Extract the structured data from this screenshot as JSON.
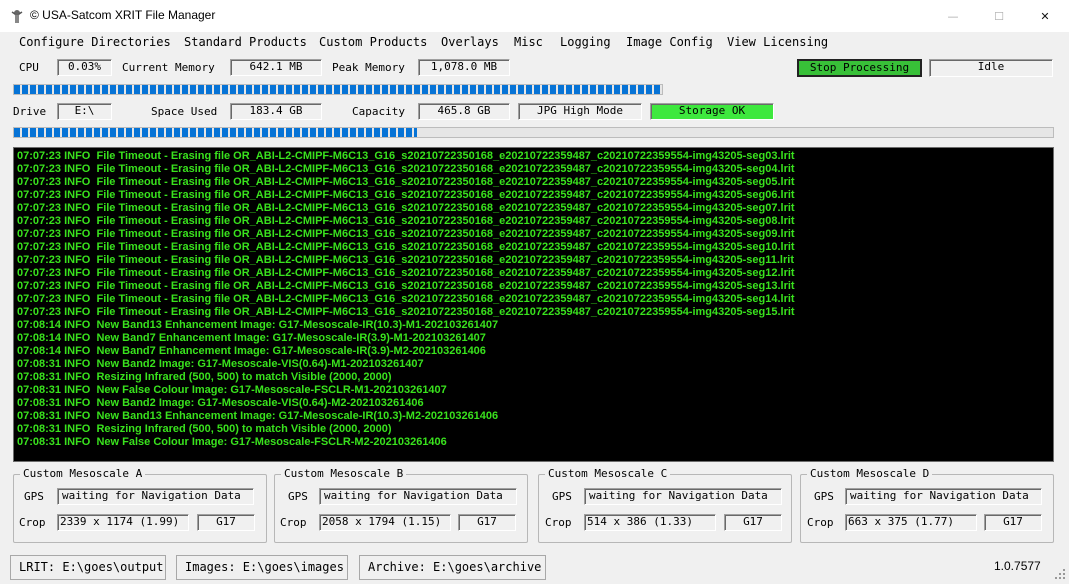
{
  "window": {
    "title": "© USA-Satcom XRIT File Manager",
    "minimize": "—",
    "maximize": "☐",
    "close": "✕"
  },
  "menu": [
    "Configure Directories",
    "Standard Products",
    "Custom Products",
    "Overlays",
    "Misc",
    "Logging",
    "Image Config",
    "View Licensing"
  ],
  "stats": {
    "cpu_label": "CPU",
    "cpu_value": "0.03%",
    "current_memory_label": "Current Memory",
    "current_memory_value": "642.1 MB",
    "peak_memory_label": "Peak Memory",
    "peak_memory_value": "1,078.0 MB",
    "stop_button": "Stop Processing",
    "state": "Idle"
  },
  "progress": {
    "top_fraction": 1.0,
    "bottom_fraction": 0.388
  },
  "drive": {
    "drive_label": "Drive",
    "drive_value": "E:\\",
    "space_used_label": "Space Used",
    "space_used_value": "183.4 GB",
    "capacity_label": "Capacity",
    "capacity_value": "465.8 GB",
    "mode": "JPG High Mode",
    "storage_status": "Storage OK",
    "storage_color": "#3ee83e"
  },
  "log": [
    "07:07:23 INFO  File Timeout - Erasing file OR_ABI-L2-CMIPF-M6C13_G16_s20210722350168_e20210722359487_c20210722359554-img43205-seg03.lrit",
    "07:07:23 INFO  File Timeout - Erasing file OR_ABI-L2-CMIPF-M6C13_G16_s20210722350168_e20210722359487_c20210722359554-img43205-seg04.lrit",
    "07:07:23 INFO  File Timeout - Erasing file OR_ABI-L2-CMIPF-M6C13_G16_s20210722350168_e20210722359487_c20210722359554-img43205-seg05.lrit",
    "07:07:23 INFO  File Timeout - Erasing file OR_ABI-L2-CMIPF-M6C13_G16_s20210722350168_e20210722359487_c20210722359554-img43205-seg06.lrit",
    "07:07:23 INFO  File Timeout - Erasing file OR_ABI-L2-CMIPF-M6C13_G16_s20210722350168_e20210722359487_c20210722359554-img43205-seg07.lrit",
    "07:07:23 INFO  File Timeout - Erasing file OR_ABI-L2-CMIPF-M6C13_G16_s20210722350168_e20210722359487_c20210722359554-img43205-seg08.lrit",
    "07:07:23 INFO  File Timeout - Erasing file OR_ABI-L2-CMIPF-M6C13_G16_s20210722350168_e20210722359487_c20210722359554-img43205-seg09.lrit",
    "07:07:23 INFO  File Timeout - Erasing file OR_ABI-L2-CMIPF-M6C13_G16_s20210722350168_e20210722359487_c20210722359554-img43205-seg10.lrit",
    "07:07:23 INFO  File Timeout - Erasing file OR_ABI-L2-CMIPF-M6C13_G16_s20210722350168_e20210722359487_c20210722359554-img43205-seg11.lrit",
    "07:07:23 INFO  File Timeout - Erasing file OR_ABI-L2-CMIPF-M6C13_G16_s20210722350168_e20210722359487_c20210722359554-img43205-seg12.lrit",
    "07:07:23 INFO  File Timeout - Erasing file OR_ABI-L2-CMIPF-M6C13_G16_s20210722350168_e20210722359487_c20210722359554-img43205-seg13.lrit",
    "07:07:23 INFO  File Timeout - Erasing file OR_ABI-L2-CMIPF-M6C13_G16_s20210722350168_e20210722359487_c20210722359554-img43205-seg14.lrit",
    "07:07:23 INFO  File Timeout - Erasing file OR_ABI-L2-CMIPF-M6C13_G16_s20210722350168_e20210722359487_c20210722359554-img43205-seg15.lrit",
    "07:08:14 INFO  New Band13 Enhancement Image: G17-Mesoscale-IR(10.3)-M1-202103261407",
    "07:08:14 INFO  New Band7 Enhancement Image: G17-Mesoscale-IR(3.9)-M1-202103261407",
    "07:08:14 INFO  New Band7 Enhancement Image: G17-Mesoscale-IR(3.9)-M2-202103261406",
    "07:08:31 INFO  New Band2 Image: G17-Mesoscale-VIS(0.64)-M1-202103261407",
    "07:08:31 INFO  Resizing Infrared (500, 500) to match Visible (2000, 2000)",
    "07:08:31 INFO  New False Colour Image: G17-Mesoscale-FSCLR-M1-202103261407",
    "07:08:31 INFO  New Band2 Image: G17-Mesoscale-VIS(0.64)-M2-202103261406",
    "07:08:31 INFO  New Band13 Enhancement Image: G17-Mesoscale-IR(10.3)-M2-202103261406",
    "07:08:31 INFO  Resizing Infrared (500, 500) to match Visible (2000, 2000)",
    "07:08:31 INFO  New False Colour Image: G17-Mesoscale-FSCLR-M2-202103261406"
  ],
  "mesoscale": [
    {
      "title": "Custom Mesoscale A",
      "gps_label": "GPS",
      "gps": "waiting for Navigation Data",
      "crop_label": "Crop",
      "crop": "2339 x 1174 (1.99)",
      "sat": "G17"
    },
    {
      "title": "Custom Mesoscale B",
      "gps_label": "GPS",
      "gps": "waiting for Navigation Data",
      "crop_label": "Crop",
      "crop": "2058 x 1794 (1.15)",
      "sat": "G17"
    },
    {
      "title": "Custom Mesoscale C",
      "gps_label": "GPS",
      "gps": "waiting for Navigation Data",
      "crop_label": "Crop",
      "crop": "514 x 386 (1.33)",
      "sat": "G17"
    },
    {
      "title": "Custom Mesoscale D",
      "gps_label": "GPS",
      "gps": "waiting for Navigation Data",
      "crop_label": "Crop",
      "crop": "663 x 375 (1.77)",
      "sat": "G17"
    }
  ],
  "statusbar": {
    "lrit": "LRIT: E:\\goes\\output",
    "images": "Images: E:\\goes\\images",
    "archive": "Archive: E:\\goes\\archive",
    "version": "1.0.7577"
  }
}
